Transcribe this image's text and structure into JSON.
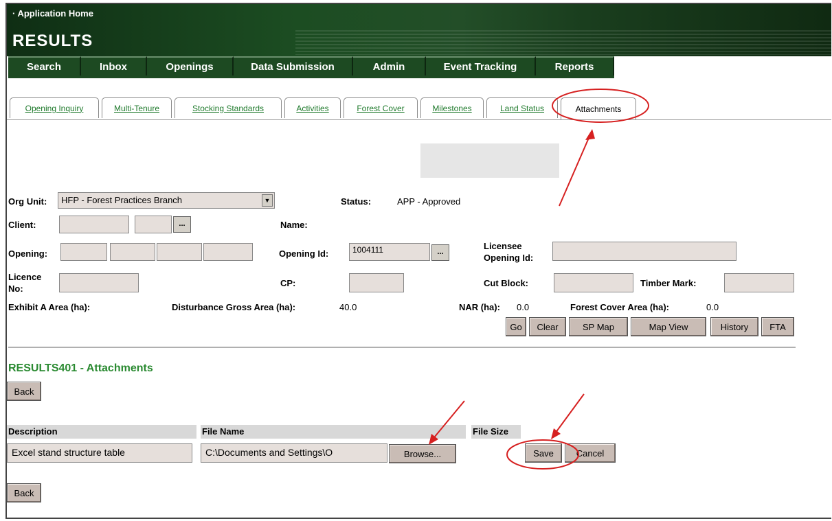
{
  "header": {
    "app_home": "· Application Home",
    "app_title": "RESULTS"
  },
  "main_nav": [
    {
      "label": "Search"
    },
    {
      "label": "Inbox"
    },
    {
      "label": "Openings"
    },
    {
      "label": "Data Submission"
    },
    {
      "label": "Admin"
    },
    {
      "label": "Event Tracking"
    },
    {
      "label": "Reports"
    }
  ],
  "sub_tabs": [
    {
      "label": "Opening Inquiry"
    },
    {
      "label": "Multi-Tenure"
    },
    {
      "label": "Stocking Standards"
    },
    {
      "label": "Activities"
    },
    {
      "label": "Forest Cover"
    },
    {
      "label": "Milestones"
    },
    {
      "label": "Land Status"
    },
    {
      "label": "Attachments",
      "active": true
    }
  ],
  "form": {
    "org_unit_label": "Org Unit:",
    "org_unit_value": "HFP - Forest Practices Branch",
    "status_label": "Status:",
    "status_value": "APP - Approved",
    "client_label": "Client:",
    "client_value": "",
    "client_location": "",
    "name_label": "Name:",
    "opening_label": "Opening:",
    "opening_id_label": "Opening Id:",
    "opening_id_value": "1004111",
    "licensee_opening_id_label_1": "Licensee",
    "licensee_opening_id_label_2": "Opening Id:",
    "licence_no_label_1": "Licence",
    "licence_no_label_2": "No:",
    "cp_label": "CP:",
    "cut_block_label": "Cut Block:",
    "timber_mark_label": "Timber Mark:",
    "exhibit_a_label": "Exhibit A Area (ha):",
    "exhibit_a_value": "",
    "disturbance_label": "Disturbance Gross Area (ha):",
    "disturbance_value": "40.0",
    "nar_label": "NAR (ha):",
    "nar_value": "0.0",
    "forest_cover_label": "Forest Cover Area (ha):",
    "forest_cover_value": "0.0",
    "ellipsis": "..."
  },
  "action_buttons": {
    "go": "Go",
    "clear": "Clear",
    "sp_map": "SP Map",
    "map_view": "Map View",
    "history": "History",
    "fta": "FTA"
  },
  "attachments": {
    "section_title": "RESULTS401 - Attachments",
    "back_label": "Back",
    "columns": [
      "Description",
      "File Name",
      "File Size"
    ],
    "row": {
      "description": "Excel stand structure table",
      "file_name": "C:\\Documents and Settings\\O",
      "file_size": ""
    },
    "browse_label": "Browse...",
    "save_label": "Save",
    "cancel_label": "Cancel"
  },
  "colors": {
    "header_green": "#1c4d22",
    "link_green": "#1f7a2c",
    "section_green": "#2a8a31",
    "annotation_red": "#d62020",
    "input_bg": "#e6dfdb"
  }
}
